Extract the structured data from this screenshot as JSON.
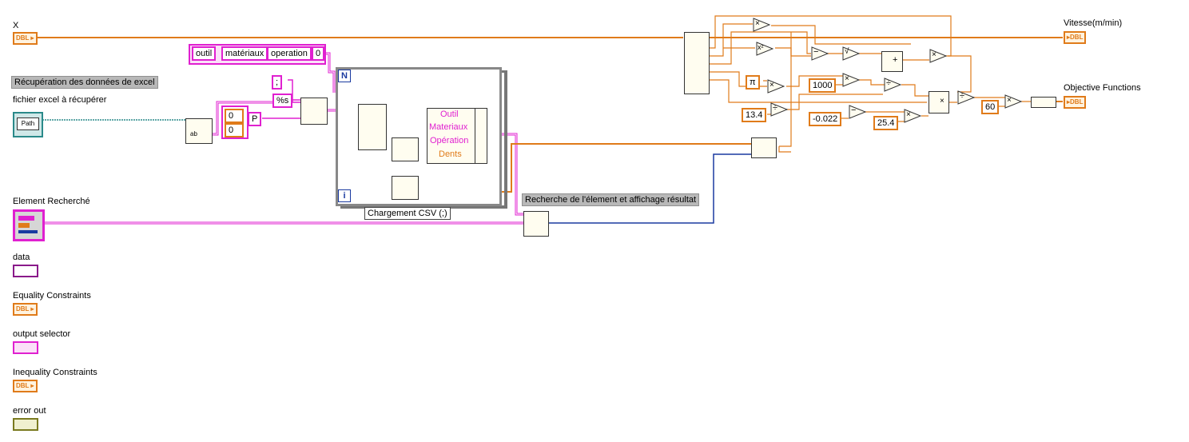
{
  "controls": {
    "x": "X",
    "excel_label": "Récupération des données de excel",
    "fichier": "fichier excel à récupérer",
    "element": "Element Recherché",
    "data": "data",
    "equality": "Equality Constraints",
    "output_selector": "output selector",
    "inequality": "Inequality Constraints",
    "error_out": "error out"
  },
  "indicators": {
    "vitesse": "Vitesse(m/min)",
    "objective": "Objective Functions"
  },
  "terminal_tags": {
    "dbl": "DBL",
    "path": "Path"
  },
  "string_array": [
    "outil",
    "matériaux",
    "operation"
  ],
  "array_index": "0",
  "format_string": "%s",
  "separator": ";",
  "index_zero": "0",
  "p_label": "P",
  "cluster_elements": [
    "Outil",
    "Materiaux",
    "Opération",
    "Dents"
  ],
  "loop": {
    "n": "N",
    "i": "i",
    "label": "Chargement CSV (;)"
  },
  "search_label": "Recherche de l'élement et affichage résultat",
  "constants": {
    "pi": "π",
    "c1000": "1000",
    "c13_4": "13.4",
    "cneg": "-0.022",
    "c25_4": "25.4",
    "c60": "60"
  },
  "ops": {
    "mult": "×",
    "div": "÷",
    "sq": "x²",
    "sub": "−",
    "sqrt": "√",
    "add": "+"
  }
}
